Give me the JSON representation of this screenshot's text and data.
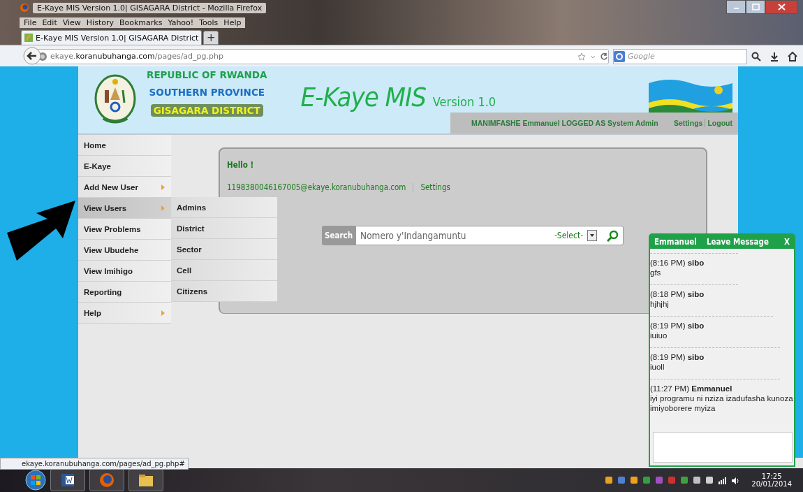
{
  "window": {
    "title": "E-Kaye MIS Version 1.0| GISAGARA District - Mozilla Firefox"
  },
  "menu_bar": [
    "File",
    "Edit",
    "View",
    "History",
    "Bookmarks",
    "Yahoo!",
    "Tools",
    "Help"
  ],
  "tabs": [
    {
      "label": "E-Kaye MIS Version 1.0| GISAGARA District",
      "selected": true
    }
  ],
  "new_tab": "+",
  "address_bar": {
    "subdomain": "ekaye.",
    "domain": "koranubuhanga.com",
    "path": "/pages/ad_pg.php"
  },
  "search_box": {
    "placeholder": "Google"
  },
  "header": {
    "lines": [
      "REPUBLIC OF RWANDA",
      "SOUTHERN PROVINCE",
      "GISAGARA DISTRICT"
    ],
    "title": "E-Kaye MIS",
    "version": "Version 1.0",
    "user_info": "MANIMFASHE Emmanuel  LOGGED AS System Admin",
    "links": [
      "Settings",
      "Logout"
    ]
  },
  "nav": [
    {
      "label": "Home",
      "has_submenu": false,
      "selected": false
    },
    {
      "label": "E-Kaye",
      "has_submenu": false,
      "selected": false
    },
    {
      "label": "Add New User",
      "has_submenu": true,
      "selected": false
    },
    {
      "label": "View Users",
      "has_submenu": true,
      "selected": true
    },
    {
      "label": "View Problems",
      "has_submenu": false,
      "selected": false
    },
    {
      "label": "View Ubudehe",
      "has_submenu": false,
      "selected": false
    },
    {
      "label": "View Imihigo",
      "has_submenu": false,
      "selected": false
    },
    {
      "label": "Reporting",
      "has_submenu": false,
      "selected": false
    },
    {
      "label": "Help",
      "has_submenu": true,
      "selected": false
    }
  ],
  "submenu": [
    "Admins",
    "District",
    "Sector",
    "Cell",
    "Citizens"
  ],
  "panel": {
    "greeting": "Hello !",
    "email": "1198380046167005@ekaye.koranubuhanga.com",
    "settings_link": "Settings",
    "search": {
      "label": "Search",
      "placeholder": "Nomero y'Indangamuntu",
      "select": "-Select-"
    }
  },
  "chat": {
    "name": "Emmanuel",
    "action": "Leave Message",
    "close": "X",
    "messages": [
      {
        "time": "(8:16 PM)",
        "sender": "sibo",
        "text": "gfs"
      },
      {
        "time": "(8:18 PM)",
        "sender": "sibo",
        "text": "hjhjhj"
      },
      {
        "time": "(8:19 PM)",
        "sender": "sibo",
        "text": "iuiuo"
      },
      {
        "time": "(8:19 PM)",
        "sender": "sibo",
        "text": "iuoll"
      },
      {
        "time": "(11:27 PM)",
        "sender": "Emmanuel",
        "text": "iyi programu ni nziza izadufasha kunoza imiyoborere myiza"
      }
    ]
  },
  "status_bar": "ekaye.koranubuhanga.com/pages/ad_pg.php#",
  "taskbar": {
    "time": "17:25",
    "date": "20/01/2014"
  }
}
